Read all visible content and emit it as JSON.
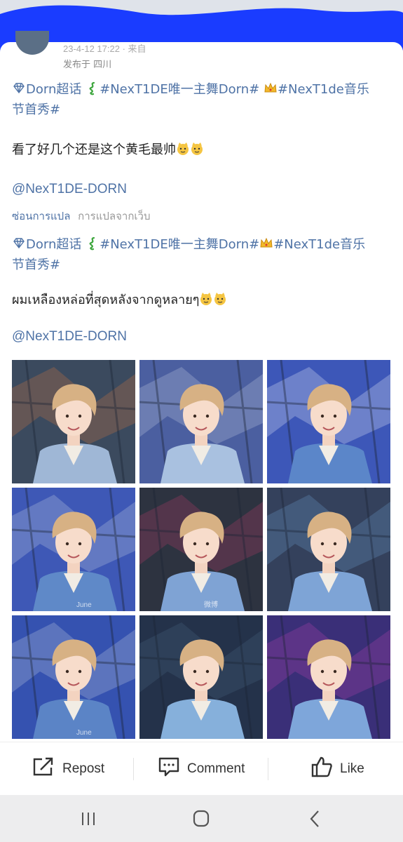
{
  "header": {
    "timestamp": "23-4-12 17:22 · 来自",
    "location": "发布于 四川"
  },
  "post": {
    "hashtags_line1": [
      "Dorn超话",
      "#NexT1DE唯一主舞Dorn#",
      "#NexT1de音乐"
    ],
    "hashtags_line2": "节首秀#",
    "body_zh": "看了好几个还是这个黄毛最帅",
    "mention": "@NexT1DE-DORN",
    "translate_hide": "ซ่อนการแปล",
    "translate_source": "การแปลจากเว็บ",
    "translated_hashtags_line1": [
      "Dorn超话",
      "#NexT1DE唯一主舞Dorn#",
      "#NexT1de音乐"
    ],
    "translated_hashtags_line2": "节首秀#",
    "body_th": "ผมเหลืองหล่อที่สุดหลังจากดูหลายๆ",
    "translated_mention": "@NexT1DE-DORN"
  },
  "photos": [
    {
      "name": "photo-1",
      "bg": "#3b4a5e",
      "jacket": "#9fb7d6",
      "accent": "#e07a3c",
      "watermark": ""
    },
    {
      "name": "photo-2",
      "bg": "#4b5fa0",
      "jacket": "#a9c1e0",
      "accent": "#cfd8e8",
      "watermark": ""
    },
    {
      "name": "photo-3",
      "bg": "#3d57b8",
      "jacket": "#5b86c9",
      "accent": "#ffffff",
      "watermark": ""
    },
    {
      "name": "photo-4",
      "bg": "#3e58b6",
      "jacket": "#5f89c8",
      "accent": "#d5dbe6",
      "watermark": "June"
    },
    {
      "name": "photo-5",
      "bg": "#2d3340",
      "jacket": "#7fa3d4",
      "accent": "#c93c6a",
      "watermark": "微博"
    },
    {
      "name": "photo-6",
      "bg": "#34415c",
      "jacket": "#7ea4d6",
      "accent": "#6fa8d8",
      "watermark": ""
    },
    {
      "name": "photo-7",
      "bg": "#3552b0",
      "jacket": "#5b84c6",
      "accent": "#d4dae3",
      "watermark": "June"
    },
    {
      "name": "photo-8",
      "bg": "#24324a",
      "jacket": "#86b0db",
      "accent": "#4a6b88",
      "watermark": ""
    },
    {
      "name": "photo-9",
      "bg": "#3a2f78",
      "jacket": "#7ea6da",
      "accent": "#c244b4",
      "watermark": ""
    }
  ],
  "actions": {
    "repost": "Repost",
    "comment": "Comment",
    "like": "Like"
  },
  "nav": {
    "icons": [
      "recent-apps-icon",
      "home-icon",
      "back-icon"
    ]
  },
  "colors": {
    "link": "#4f73a6",
    "redaction": "#1a3cff"
  }
}
